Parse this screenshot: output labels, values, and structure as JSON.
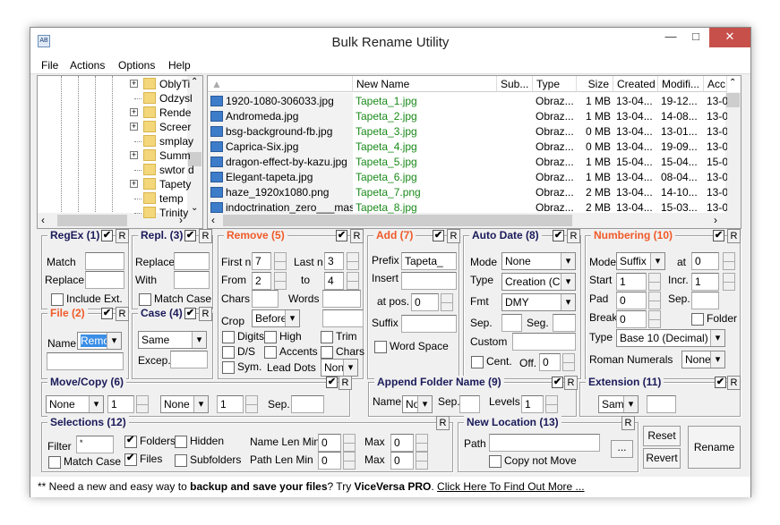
{
  "window": {
    "title": "Bulk Rename Utility",
    "minimize": "—",
    "maximize": "□",
    "close": "✕"
  },
  "menu": [
    "File",
    "Actions",
    "Options",
    "Help"
  ],
  "tree": [
    {
      "label": "OblyTi",
      "expand": true
    },
    {
      "label": "Odzysl",
      "expand": false
    },
    {
      "label": "Rende",
      "expand": true
    },
    {
      "label": "Screer",
      "expand": true
    },
    {
      "label": "smplay",
      "expand": false
    },
    {
      "label": "Summ",
      "expand": true
    },
    {
      "label": "swtor d",
      "expand": false
    },
    {
      "label": "Tapety",
      "expand": true
    },
    {
      "label": "temp",
      "expand": false
    },
    {
      "label": "Trinity",
      "expand": false
    }
  ],
  "list": {
    "columns": [
      "",
      "New Name",
      "Sub...",
      "Type",
      "Size",
      "Created",
      "Modifi...",
      "Acc"
    ],
    "rows": [
      [
        "1920-1080-306033.jpg",
        "Tapeta_1.jpg",
        "",
        "Obraz...",
        "1 MB",
        "13-04...",
        "19-12...",
        "13-0"
      ],
      [
        "Andromeda.jpg",
        "Tapeta_2.jpg",
        "",
        "Obraz...",
        "1 MB",
        "13-04...",
        "14-08...",
        "13-0"
      ],
      [
        "bsg-background-fb.jpg",
        "Tapeta_3.jpg",
        "",
        "Obraz...",
        "0 MB",
        "13-04...",
        "13-01...",
        "13-0"
      ],
      [
        "Caprica-Six.jpg",
        "Tapeta_4.jpg",
        "",
        "Obraz...",
        "0 MB",
        "13-04...",
        "19-09...",
        "13-0"
      ],
      [
        "dragon-effect-by-kazu.jpg",
        "Tapeta_5.jpg",
        "",
        "Obraz...",
        "1 MB",
        "15-04...",
        "15-04...",
        "15-0"
      ],
      [
        "Elegant-tapeta.jpg",
        "Tapeta_6.jpg",
        "",
        "Obraz...",
        "1 MB",
        "13-04...",
        "08-04...",
        "13-0"
      ],
      [
        "haze_1920x1080.png",
        "Tapeta_7.png",
        "",
        "Obraz...",
        "2 MB",
        "13-04...",
        "14-10...",
        "13-0"
      ],
      [
        "indoctrination_zero___mas...",
        "Tapeta_8.jpg",
        "",
        "Obraz...",
        "2 MB",
        "13-04...",
        "15-03...",
        "13-0"
      ]
    ]
  },
  "regex": {
    "title": "RegEx (1)",
    "match": "Match",
    "replace": "Replace",
    "include_ext": "Include Ext.",
    "r": "R"
  },
  "repl": {
    "title": "Repl. (3)",
    "replace": "Replace",
    "with": "With",
    "match_case": "Match Case"
  },
  "file": {
    "title": "File (2)",
    "name": "Name",
    "name_value": "Remo"
  },
  "case": {
    "title": "Case (4)",
    "value": "Same",
    "excep": "Excep."
  },
  "remove": {
    "title": "Remove (5)",
    "first_n": "First n",
    "first_n_value": "7",
    "last_n": "Last n",
    "last_n_value": "3",
    "from": "From",
    "from_value": "2",
    "to": "to",
    "to_value": "4",
    "chars": "Chars",
    "words": "Words",
    "crop": "Crop",
    "crop_value": "Before",
    "digits": "Digits",
    "high": "High",
    "trim": "Trim",
    "ds": "D/S",
    "accents": "Accents",
    "chars2": "Chars",
    "sym": "Sym.",
    "lead_dots": "Lead Dots",
    "lead_dots_value": "Non"
  },
  "add": {
    "title": "Add (7)",
    "prefix": "Prefix",
    "prefix_value": "Tapeta_",
    "insert": "Insert",
    "at_pos": "at pos.",
    "at_pos_value": "0",
    "suffix": "Suffix",
    "word_space": "Word Space"
  },
  "autodate": {
    "title": "Auto Date (8)",
    "mode": "Mode",
    "mode_value": "None",
    "type": "Type",
    "type_value": "Creation (Cur",
    "fmt": "Fmt",
    "fmt_value": "DMY",
    "sep": "Sep.",
    "seg": "Seg.",
    "custom": "Custom",
    "cent": "Cent.",
    "off": "Off.",
    "off_value": "0"
  },
  "numbering": {
    "title": "Numbering (10)",
    "mode": "Mode",
    "mode_value": "Suffix",
    "at": "at",
    "at_value": "0",
    "start": "Start",
    "start_value": "1",
    "incr": "Incr.",
    "incr_value": "1",
    "pad": "Pad",
    "pad_value": "0",
    "sep": "Sep.",
    "break": "Break",
    "break_value": "0",
    "folder": "Folder",
    "type": "Type",
    "type_value": "Base 10 (Decimal)",
    "roman": "Roman Numerals",
    "roman_value": "None"
  },
  "movecopy": {
    "title": "Move/Copy (6)",
    "mode1": "None",
    "n1": "1",
    "mode2": "None",
    "n2": "1",
    "sep": "Sep."
  },
  "appendfolder": {
    "title": "Append Folder Name (9)",
    "name": "Name",
    "name_value": "None",
    "sep": "Sep.",
    "levels": "Levels",
    "levels_value": "1"
  },
  "extension": {
    "title": "Extension (11)",
    "value": "Same"
  },
  "selections": {
    "title": "Selections (12)",
    "filter": "Filter",
    "filter_value": "*",
    "folders": "Folders",
    "hidden": "Hidden",
    "files": "Files",
    "subfolders": "Subfolders",
    "match_case": "Match Case",
    "name_len_min": "Name Len Min",
    "name_len_min_value": "0",
    "path_len_min": "Path Len Min",
    "path_len_min_value": "0",
    "max": "Max",
    "name_max_value": "0",
    "path_max_value": "0"
  },
  "newlocation": {
    "title": "New Location (13)",
    "path": "Path",
    "browse": "...",
    "copy_not_move": "Copy not Move"
  },
  "buttons": {
    "reset": "Reset",
    "revert": "Revert",
    "rename": "Rename"
  },
  "footer": {
    "prefix": "** Need a new and easy way to ",
    "bold1": "backup and save your files",
    "mid": "? Try ",
    "bold2": "ViceVersa PRO",
    "end": ". ",
    "link": "Click Here To Find Out More ..."
  },
  "colors": {
    "accent_title": "#f05a28",
    "title_blue": "#1a1a5a",
    "new_name": "#1a8a1a",
    "close": "#c7504a"
  }
}
